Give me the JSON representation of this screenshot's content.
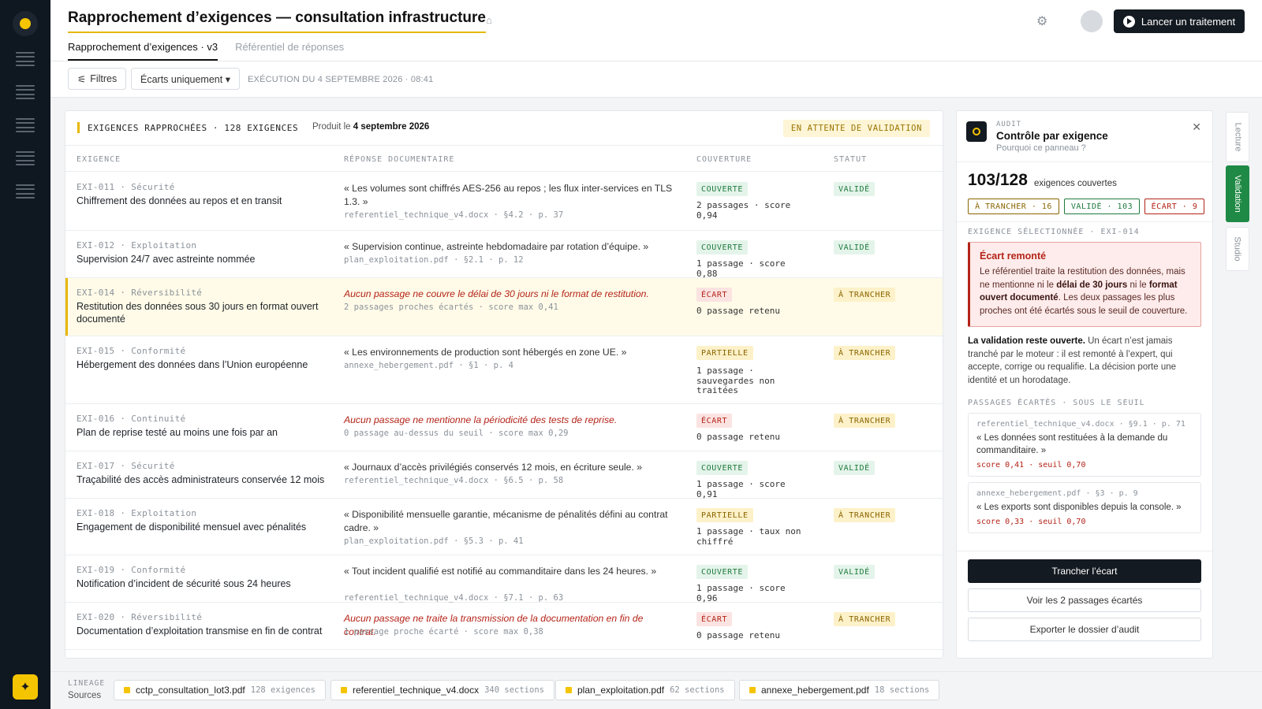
{
  "rail": {
    "items": [
      "menu-1",
      "menu-2",
      "menu-3",
      "menu-4",
      "menu-5"
    ],
    "accent": "#f5c400"
  },
  "header": {
    "title": "Rapprochement d’exigences — consultation infrastructure",
    "tabs": [
      {
        "label": "Rapprochement d’exigences · v3",
        "active": true
      },
      {
        "label": "Référentiel de réponses",
        "active": false
      }
    ],
    "run_label": "Lancer un traitement"
  },
  "toolbar": {
    "filters_label": "Filtres",
    "gaps_label": "Écarts uniquement ▾",
    "execution": "EXÉCUTION DU 4 SEPTEMBRE 2026 · 08:41"
  },
  "table": {
    "title": "EXIGENCES RAPPROCHÉES · 128 EXIGENCES",
    "produced_prefix": "Produit le",
    "produced_date": "4 septembre 2026",
    "status_pill": "EN ATTENTE DE VALIDATION",
    "columns": [
      "EXIGENCE",
      "RÉPONSE DOCUMENTAIRE",
      "COUVERTURE",
      "STATUT"
    ],
    "rows": [
      {
        "id": "EXI-011 · Sécurité",
        "title": "Chiffrement des données au repos et en transit",
        "quote": "« Les volumes sont chiffrés AES-256 au repos ; les flux inter-services en TLS 1.3. »",
        "missing": false,
        "source": "referentiel_technique_v4.docx · §4.2 · p. 37",
        "coverage": "COUVERTE",
        "coverage_kind": "ok",
        "coverage_detail": "2 passages · score 0,94",
        "status": "VALIDÉ",
        "status_kind": "ok",
        "selected": false
      },
      {
        "id": "EXI-012 · Exploitation",
        "title": "Supervision 24/7 avec astreinte nommée",
        "quote": "« Supervision continue, astreinte hebdomadaire par rotation d’équipe. »",
        "missing": false,
        "source": "plan_exploitation.pdf · §2.1 · p. 12",
        "coverage": "COUVERTE",
        "coverage_kind": "ok",
        "coverage_detail": "1 passage · score 0,88",
        "status": "VALIDÉ",
        "status_kind": "ok",
        "selected": false
      },
      {
        "id": "EXI-014 · Réversibilité",
        "title": "Restitution des données sous 30 jours en format ouvert documenté",
        "quote": "Aucun passage ne couvre le délai de 30 jours ni le format de restitution.",
        "missing": true,
        "source": "2 passages proches écartés · score max 0,41",
        "coverage": "ÉCART",
        "coverage_kind": "gap",
        "coverage_detail": "0 passage retenu",
        "status": "À TRANCHER",
        "status_kind": "trancher",
        "selected": true
      },
      {
        "id": "EXI-015 · Conformité",
        "title": "Hébergement des données dans l’Union européenne",
        "quote": "« Les environnements de production sont hébergés en zone UE. »",
        "missing": false,
        "source": "annexe_hebergement.pdf · §1 · p. 4",
        "coverage": "PARTIELLE",
        "coverage_kind": "part",
        "coverage_detail": "1 passage · sauvegardes non traitées",
        "status": "À TRANCHER",
        "status_kind": "trancher",
        "selected": false
      },
      {
        "id": "EXI-016 · Continuité",
        "title": "Plan de reprise testé au moins une fois par an",
        "quote": "Aucun passage ne mentionne la périodicité des tests de reprise.",
        "missing": true,
        "source": "0 passage au-dessus du seuil · score max 0,29",
        "coverage": "ÉCART",
        "coverage_kind": "gap",
        "coverage_detail": "0 passage retenu",
        "status": "À TRANCHER",
        "status_kind": "trancher",
        "selected": false
      },
      {
        "id": "EXI-017 · Sécurité",
        "title": "Traçabilité des accès administrateurs conservée 12 mois",
        "quote": "« Journaux d’accès privilégiés conservés 12 mois, en écriture seule. »",
        "missing": false,
        "source": "referentiel_technique_v4.docx · §6.5 · p. 58",
        "coverage": "COUVERTE",
        "coverage_kind": "ok",
        "coverage_detail": "1 passage · score 0,91",
        "status": "VALIDÉ",
        "status_kind": "ok",
        "selected": false
      },
      {
        "id": "EXI-018 · Exploitation",
        "title": "Engagement de disponibilité mensuel avec pénalités",
        "quote": "« Disponibilité mensuelle garantie, mécanisme de pénalités défini au contrat cadre. »",
        "missing": false,
        "source": "plan_exploitation.pdf · §5.3 · p. 41",
        "coverage": "PARTIELLE",
        "coverage_kind": "part",
        "coverage_detail": "1 passage · taux non chiffré",
        "status": "À TRANCHER",
        "status_kind": "trancher",
        "selected": false
      },
      {
        "id": "EXI-019 · Conformité",
        "title": "Notification d’incident de sécurité sous 24 heures",
        "quote": "« Tout incident qualifié est notifié au commanditaire dans les 24 heures. »",
        "missing": false,
        "source": "referentiel_technique_v4.docx · §7.1 · p. 63",
        "coverage": "COUVERTE",
        "coverage_kind": "ok",
        "coverage_detail": "1 passage · score 0,96",
        "status": "VALIDÉ",
        "status_kind": "ok",
        "selected": false
      },
      {
        "id": "EXI-020 · Réversibilité",
        "title": "Documentation d’exploitation transmise en fin de contrat",
        "quote": "Aucun passage ne traite la transmission de la documentation en fin de contrat.",
        "missing": true,
        "source": "1 passage proche écarté · score max 0,38",
        "coverage": "ÉCART",
        "coverage_kind": "gap",
        "coverage_detail": "0 passage retenu",
        "status": "À TRANCHER",
        "status_kind": "trancher",
        "selected": false
      }
    ]
  },
  "audit": {
    "kicker": "AUDIT",
    "title": "Contrôle par exigence",
    "subtitle": "Pourquoi ce panneau ?",
    "covered": "103/128",
    "covered_label": "exigences couvertes",
    "chips": [
      {
        "label": "À TRANCHER · 16",
        "kind": "trancher"
      },
      {
        "label": "VALIDÉ · 103",
        "kind": "ok"
      },
      {
        "label": "ÉCART · 9",
        "kind": "gap"
      }
    ],
    "selected_label": "EXIGENCE SÉLECTIONNÉE · EXI-014",
    "gap_title": "Écart remonté",
    "gap_text_1": "Le référentiel traite la restitution des données, mais ne mentionne ni le ",
    "gap_bold_1": "délai de 30 jours",
    "gap_text_2": " ni le ",
    "gap_bold_2": "format ouvert documenté",
    "gap_text_3": ". Les deux passages les plus proches ont été écartés sous le seuil de couverture.",
    "validation_bold": "La validation reste ouverte.",
    "validation_text": " Un écart n’est jamais tranché par le moteur : il est remonté à l’expert, qui accepte, corrige ou requalifie. La décision porte une identité et un horodatage.",
    "passages_label": "PASSAGES ÉCARTÉS · SOUS LE SEUIL",
    "passages": [
      {
        "source": "referentiel_technique_v4.docx · §9.1 · p. 71",
        "quote": "« Les données sont restituées à la demande du commanditaire. »",
        "score": "score 0,41 · seuil 0,70"
      },
      {
        "source": "annexe_hebergement.pdf · §3 · p. 9",
        "quote": "« Les exports sont disponibles depuis la console. »",
        "score": "score 0,33 · seuil 0,70"
      }
    ],
    "btn_primary": "Trancher l’écart",
    "btn_view": "Voir les 2 passages écartés",
    "btn_export": "Exporter le dossier d’audit"
  },
  "side_tabs": [
    {
      "label": "Lecture",
      "active": false
    },
    {
      "label": "Validation",
      "active": true
    },
    {
      "label": "Studio",
      "active": false
    }
  ],
  "lineage": {
    "kicker": "LINEAGE",
    "label": "Sources",
    "sources": [
      {
        "name": "cctp_consultation_lot3.pdf",
        "count": "128 exigences"
      },
      {
        "name": "referentiel_technique_v4.docx",
        "count": "340 sections"
      },
      {
        "name": "plan_exploitation.pdf",
        "count": "62 sections"
      },
      {
        "name": "annexe_hebergement.pdf",
        "count": "18 sections"
      }
    ]
  },
  "colors": {
    "accent": "#e6b800",
    "ok": "#1f7a3e",
    "gap": "#b42318",
    "warn": "#8a6500",
    "dark": "#141a21"
  }
}
